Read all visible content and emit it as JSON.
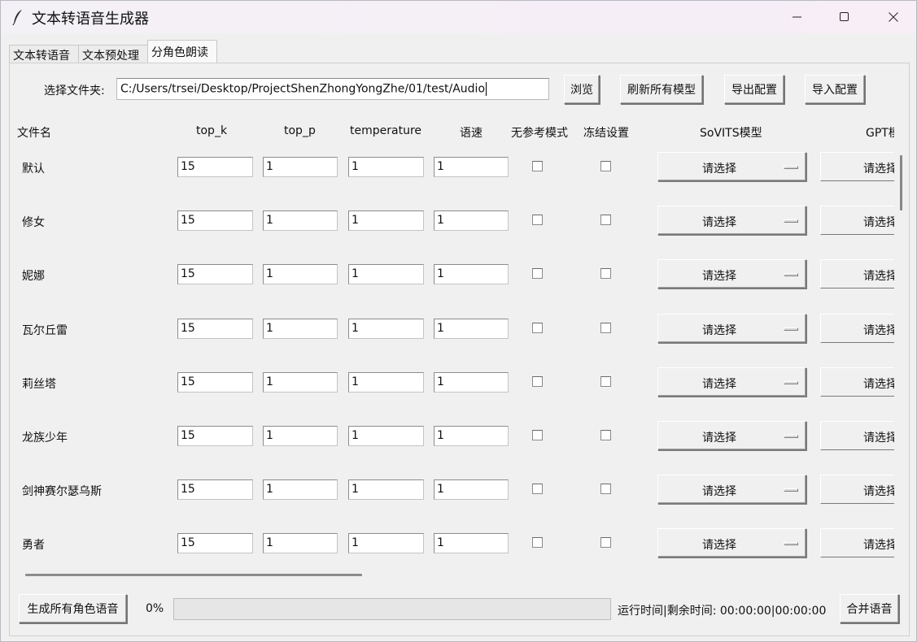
{
  "window": {
    "title": "文本转语音生成器",
    "controls": [
      "minimize-icon",
      "maximize-icon",
      "close-icon"
    ]
  },
  "tabs": [
    {
      "label": "文本转语音",
      "active": false
    },
    {
      "label": "文本预处理",
      "active": false
    },
    {
      "label": "分角色朗读",
      "active": true
    }
  ],
  "toolbar": {
    "folder_label": "选择文件夹:",
    "folder_value": "C:/Users/trsei/Desktop/ProjectShenZhongYongZhe/01/test/Audio",
    "browse": "浏览",
    "refresh_models": "刷新所有模型",
    "export_config": "导出配置",
    "import_config": "导入配置"
  },
  "headers": {
    "filename": "文件名",
    "top_k": "top_k",
    "top_p": "top_p",
    "temperature": "temperature",
    "speed": "语速",
    "no_ref": "无参考模式",
    "freeze": "冻结设置",
    "sovits": "SoVITS模型",
    "gpt": "GPT模"
  },
  "select_placeholder": "请选择",
  "gpt_placeholder": "请选择",
  "rows": [
    {
      "name": "默认",
      "top_k": "15",
      "top_p": "1",
      "temperature": "1",
      "speed": "1",
      "no_ref": false,
      "freeze": false
    },
    {
      "name": "修女",
      "top_k": "15",
      "top_p": "1",
      "temperature": "1",
      "speed": "1",
      "no_ref": false,
      "freeze": false
    },
    {
      "name": "妮娜",
      "top_k": "15",
      "top_p": "1",
      "temperature": "1",
      "speed": "1",
      "no_ref": false,
      "freeze": false
    },
    {
      "name": "瓦尔丘雷",
      "top_k": "15",
      "top_p": "1",
      "temperature": "1",
      "speed": "1",
      "no_ref": false,
      "freeze": false
    },
    {
      "name": "莉丝塔",
      "top_k": "15",
      "top_p": "1",
      "temperature": "1",
      "speed": "1",
      "no_ref": false,
      "freeze": false
    },
    {
      "name": "龙族少年",
      "top_k": "15",
      "top_p": "1",
      "temperature": "1",
      "speed": "1",
      "no_ref": false,
      "freeze": false
    },
    {
      "name": "剑神赛尔瑟乌斯",
      "top_k": "15",
      "top_p": "1",
      "temperature": "1",
      "speed": "1",
      "no_ref": false,
      "freeze": false
    },
    {
      "name": "勇者",
      "top_k": "15",
      "top_p": "1",
      "temperature": "1",
      "speed": "1",
      "no_ref": false,
      "freeze": false
    }
  ],
  "footer": {
    "generate_all": "生成所有角色语音",
    "progress_text": "0%",
    "progress_fraction": 0,
    "timer": "运行时间|剩余时间: 00:00:00|00:00:00",
    "merge": "合并语音"
  }
}
